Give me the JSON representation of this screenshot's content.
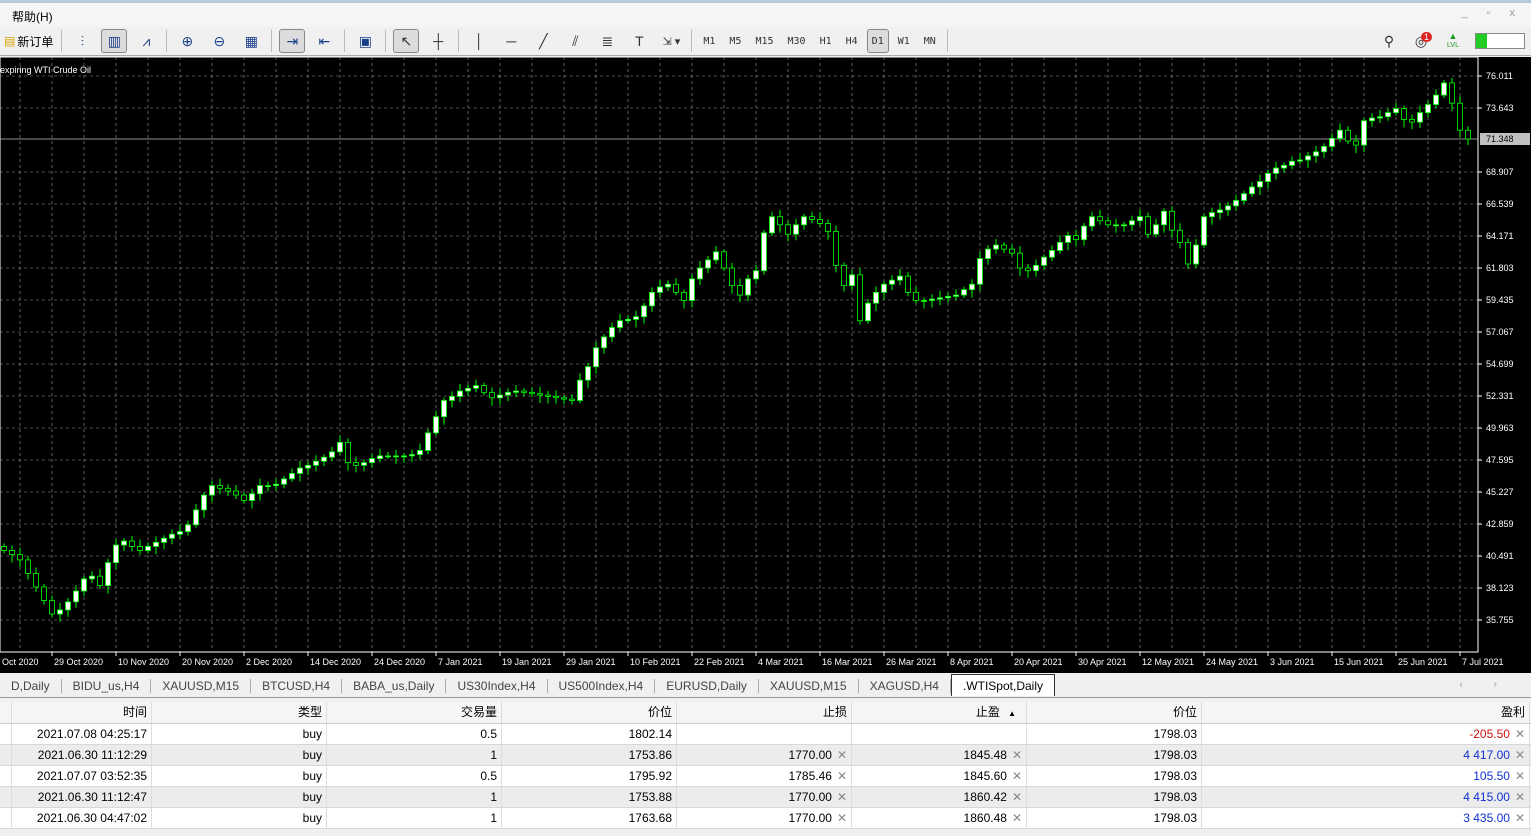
{
  "menu": {
    "help": "帮助(H)",
    "window_controls": "_ ▫ x"
  },
  "toolbar": {
    "new_order": "新订单",
    "timeframes": [
      "M1",
      "M5",
      "M15",
      "M30",
      "H1",
      "H4",
      "D1",
      "W1",
      "MN"
    ],
    "active_timeframe": "D1",
    "notification_count": "1",
    "lvl": "LVL"
  },
  "chart": {
    "symbol_desc": "expiring WTI Crude Oil",
    "price_labels": [
      "76.011",
      "73.643",
      "68.907",
      "66.539",
      "64.171",
      "61.803",
      "59.435",
      "57.067",
      "54.699",
      "52.331",
      "49.963",
      "47.595",
      "45.227",
      "42.859",
      "40.491",
      "38.123",
      "35.755"
    ],
    "current_price": "71.348",
    "date_labels": [
      "Oct 2020",
      "29 Oct 2020",
      "10 Nov 2020",
      "20 Nov 2020",
      "2 Dec 2020",
      "14 Dec 2020",
      "24 Dec 2020",
      "7 Jan 2021",
      "19 Jan 2021",
      "29 Jan 2021",
      "10 Feb 2021",
      "22 Feb 2021",
      "4 Mar 2021",
      "16 Mar 2021",
      "26 Mar 2021",
      "8 Apr 2021",
      "20 Apr 2021",
      "30 Apr 2021",
      "12 May 2021",
      "24 May 2021",
      "3 Jun 2021",
      "15 Jun 2021",
      "25 Jun 2021",
      "7 Jul 2021"
    ],
    "colors": {
      "background": "#000000",
      "grid": "#c0c0c0",
      "candle": "#00ff00",
      "bull_body": "#ffffff",
      "bear_body": "#000000"
    }
  },
  "chart_data": {
    "type": "candlestick",
    "ylim": [
      34.5,
      77.5
    ],
    "grid": true,
    "closes": [
      40.9,
      40.6,
      40.2,
      39.2,
      38.2,
      37.2,
      36.2,
      36.5,
      37.1,
      37.9,
      38.8,
      39.0,
      38.3,
      40.0,
      41.3,
      41.6,
      41.2,
      40.9,
      41.2,
      41.5,
      41.8,
      42.1,
      42.3,
      42.8,
      43.9,
      45.0,
      45.7,
      45.5,
      45.3,
      45.0,
      44.6,
      45.1,
      45.7,
      45.7,
      45.8,
      46.2,
      46.6,
      47.0,
      47.2,
      47.5,
      47.8,
      48.2,
      48.9,
      47.4,
      47.2,
      47.4,
      47.7,
      47.9,
      47.9,
      47.9,
      47.9,
      48.0,
      48.3,
      49.6,
      50.8,
      52.0,
      52.3,
      52.7,
      52.9,
      53.1,
      52.6,
      52.2,
      52.4,
      52.6,
      52.7,
      52.6,
      52.5,
      52.4,
      52.3,
      52.2,
      52.1,
      52.0,
      53.5,
      54.5,
      55.9,
      56.7,
      57.4,
      57.9,
      58.0,
      58.2,
      59.0,
      60.0,
      60.4,
      60.6,
      60.0,
      59.4,
      61.0,
      61.8,
      62.4,
      63.0,
      61.8,
      60.5,
      59.8,
      61.0,
      61.6,
      64.4,
      65.6,
      65.0,
      64.3,
      65.0,
      65.6,
      65.4,
      65.1,
      64.5,
      62.0,
      60.5,
      61.3,
      57.9,
      59.2,
      60.0,
      60.6,
      60.9,
      61.2,
      60.0,
      59.4,
      59.4,
      59.5,
      59.6,
      59.7,
      59.8,
      60.2,
      60.6,
      62.5,
      63.2,
      63.5,
      63.2,
      62.9,
      61.8,
      61.6,
      62.0,
      62.6,
      63.1,
      63.7,
      64.2,
      63.9,
      64.9,
      65.6,
      65.3,
      65.0,
      65.0,
      65.0,
      65.3,
      65.6,
      64.3,
      65.0,
      66.0,
      64.6,
      63.7,
      62.1,
      63.5,
      65.6,
      65.9,
      66.1,
      66.4,
      66.8,
      67.3,
      67.8,
      68.2,
      68.8,
      69.2,
      69.4,
      69.7,
      69.8,
      70.1,
      70.4,
      70.8,
      71.4,
      72.0,
      71.2,
      70.9,
      72.7,
      72.9,
      73.0,
      73.3,
      73.6,
      72.8,
      72.6,
      73.3,
      73.9,
      74.6,
      75.5,
      74.0,
      72.0,
      71.35
    ]
  },
  "tabs": [
    "D,Daily",
    "BIDU_us,H4",
    "XAUUSD,M15",
    "BTCUSD,H4",
    "BABA_us,Daily",
    "US30Index,H4",
    "US500Index,H4",
    "EURUSD,Daily",
    "XAUUSD,M15",
    "XAGUSD,H4",
    ".WTISpot,Daily"
  ],
  "active_tab": ".WTISpot,Daily",
  "table": {
    "headers": [
      "时间",
      "类型",
      "交易量",
      "价位",
      "止损",
      "止盈",
      "价位",
      "盈利"
    ],
    "sort_column": "止盈",
    "rows": [
      [
        "2021.07.08 04:25:17",
        "buy",
        "0.5",
        "1802.14",
        "",
        "",
        "1798.03",
        "-205.50"
      ],
      [
        "2021.06.30 11:12:29",
        "buy",
        "1",
        "1753.86",
        "1770.00",
        "1845.48",
        "1798.03",
        "4 417.00"
      ],
      [
        "2021.07.07 03:52:35",
        "buy",
        "0.5",
        "1795.92",
        "1785.46",
        "1845.60",
        "1798.03",
        "105.50"
      ],
      [
        "2021.06.30 11:12:47",
        "buy",
        "1",
        "1753.88",
        "1770.00",
        "1860.42",
        "1798.03",
        "4 415.00"
      ],
      [
        "2021.06.30 04:47:02",
        "buy",
        "1",
        "1763.68",
        "1770.00",
        "1860.48",
        "1798.03",
        "3 435.00"
      ]
    ]
  }
}
